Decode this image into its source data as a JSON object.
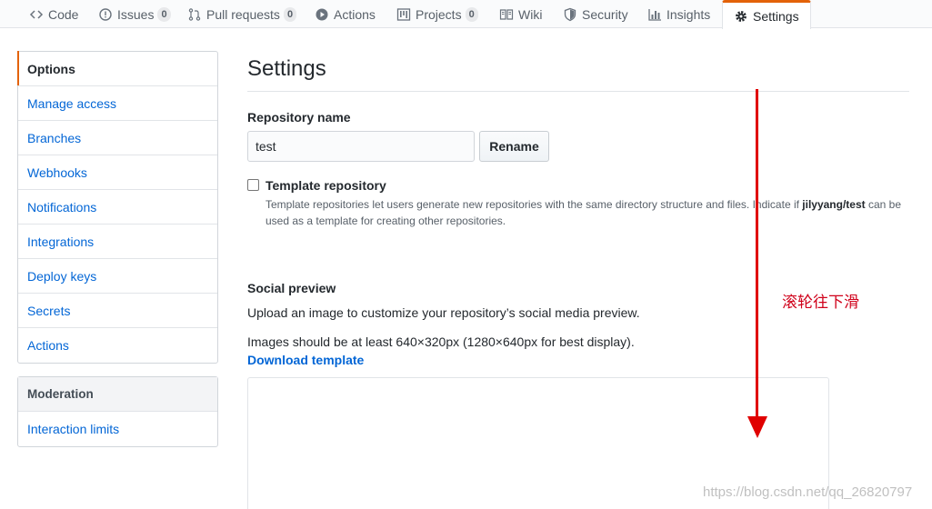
{
  "tabs": [
    {
      "label": "Code",
      "icon": "code-icon"
    },
    {
      "label": "Issues",
      "icon": "issue-icon",
      "count": "0"
    },
    {
      "label": "Pull requests",
      "icon": "pull-request-icon",
      "count": "0"
    },
    {
      "label": "Actions",
      "icon": "play-icon"
    },
    {
      "label": "Projects",
      "icon": "project-icon",
      "count": "0"
    },
    {
      "label": "Wiki",
      "icon": "book-icon"
    },
    {
      "label": "Security",
      "icon": "shield-icon"
    },
    {
      "label": "Insights",
      "icon": "graph-icon"
    },
    {
      "label": "Settings",
      "icon": "gear-icon",
      "selected": true
    }
  ],
  "sidebar": {
    "items": [
      {
        "label": "Options",
        "selected": true
      },
      {
        "label": "Manage access"
      },
      {
        "label": "Branches"
      },
      {
        "label": "Webhooks"
      },
      {
        "label": "Notifications"
      },
      {
        "label": "Integrations"
      },
      {
        "label": "Deploy keys"
      },
      {
        "label": "Secrets"
      },
      {
        "label": "Actions"
      }
    ],
    "moderation": {
      "heading": "Moderation",
      "items": [
        {
          "label": "Interaction limits"
        }
      ]
    }
  },
  "main": {
    "title": "Settings",
    "repo_name_label": "Repository name",
    "repo_name_value": "test",
    "rename_button": "Rename",
    "template": {
      "label": "Template repository",
      "checked": false,
      "note_before": "Template repositories let users generate new repositories with the same directory structure and files. Indicate if ",
      "note_repo": "jilyyang/test",
      "note_after": " can be used as a template for creating other repositories."
    },
    "social": {
      "heading": "Social preview",
      "description": "Upload an image to customize your repository’s social media preview.",
      "requirement": "Images should be at least 640×320px (1280×640px for best display).",
      "download_link": "Download template"
    }
  },
  "annotation": {
    "text": "滚轮往下滑",
    "color": "#e00000"
  },
  "watermark": "https://blog.csdn.net/qq_26820797",
  "colors": {
    "accent": "#e36209",
    "link": "#0366d6"
  }
}
